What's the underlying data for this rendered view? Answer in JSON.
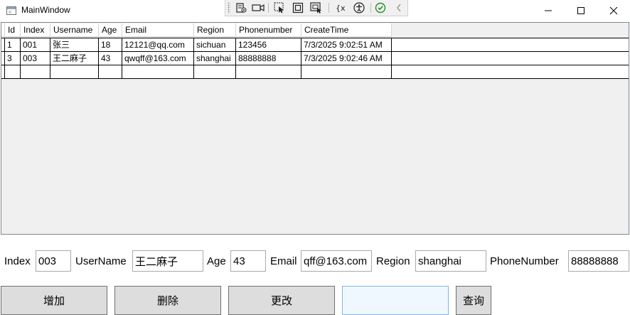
{
  "window": {
    "title": "MainWindow"
  },
  "grid": {
    "columns": [
      "Id",
      "Index",
      "Username",
      "Age",
      "Email",
      "Region",
      "Phonenumber",
      "CreateTime"
    ],
    "rows": [
      [
        "1",
        "001",
        "张三",
        "18",
        "12121@qq.com",
        "sichuan",
        "123456",
        "7/3/2025 9:02:51 AM"
      ],
      [
        "3",
        "003",
        "王二麻子",
        "43",
        "qwqff@163.com",
        "shanghai",
        "88888888",
        "7/3/2025 9:02:46 AM"
      ]
    ]
  },
  "form": {
    "index_label": "Index",
    "index_value": "003",
    "username_label": "UserName",
    "username_value": "王二麻子",
    "age_label": "Age",
    "age_value": "43",
    "email_label": "Email",
    "email_value": "qff@163.com",
    "region_label": "Region",
    "region_value": "shanghai",
    "phone_label": "PhoneNumber",
    "phone_value": "88888888"
  },
  "actions": {
    "add_label": "增加",
    "delete_label": "删除",
    "update_label": "更改",
    "query_value": "",
    "query_label": "查询"
  },
  "colors": {
    "grid_background": "#f0f0f0",
    "button_background": "#dddddd",
    "query_input_border": "#7eb4ea",
    "query_input_background": "#f0f8ff"
  }
}
